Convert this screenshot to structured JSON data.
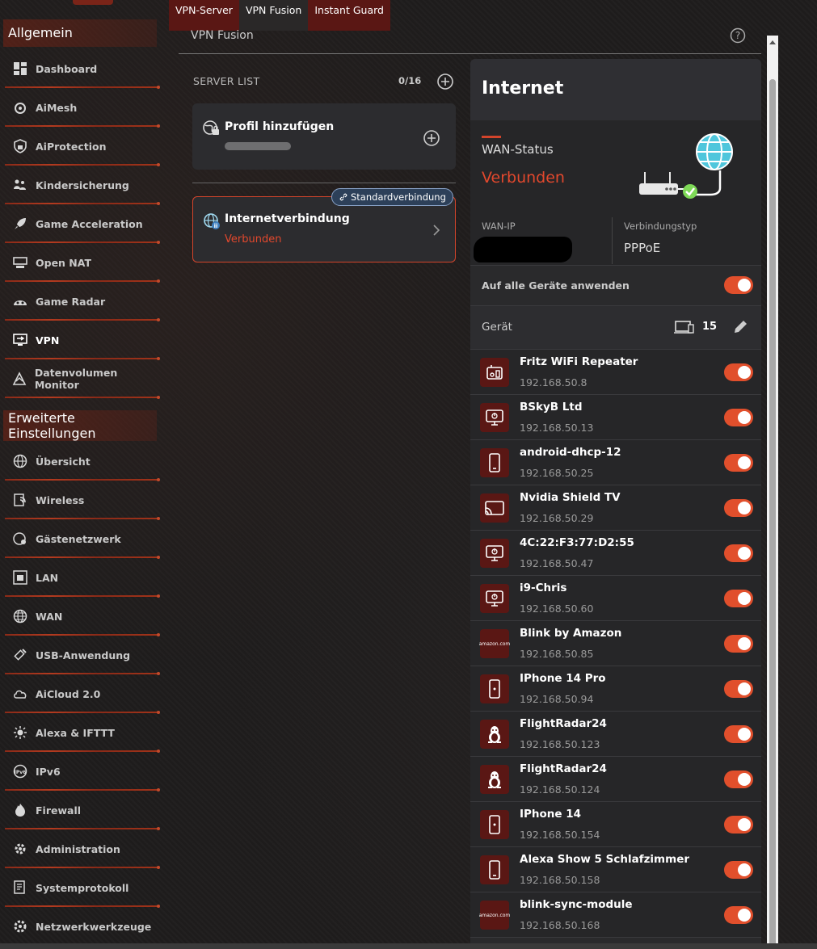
{
  "tabs": [
    {
      "label": "VPN-Server"
    },
    {
      "label": "VPN Fusion"
    },
    {
      "label": "Instant Guard"
    }
  ],
  "sidebar": {
    "section_general": "Allgemein",
    "section_advanced": "Erweiterte Einstellungen",
    "general_items": [
      {
        "label": "Dashboard",
        "icon": "dashboard-icon"
      },
      {
        "label": "AiMesh",
        "icon": "aimesh-icon"
      },
      {
        "label": "AiProtection",
        "icon": "lock-shield-icon"
      },
      {
        "label": "Kindersicherung",
        "icon": "family-icon"
      },
      {
        "label": "Game Acceleration",
        "icon": "rocket-icon"
      },
      {
        "label": "Open NAT",
        "icon": "nat-icon"
      },
      {
        "label": "Game Radar",
        "icon": "radar-icon"
      },
      {
        "label": "VPN",
        "icon": "vpn-icon"
      },
      {
        "label": "Datenvolumen Monitor",
        "icon": "traffic-monitor-icon"
      }
    ],
    "advanced_items": [
      {
        "label": "Übersicht",
        "icon": "overview-globe-icon"
      },
      {
        "label": "Wireless",
        "icon": "wireless-icon"
      },
      {
        "label": "Gästenetzwerk",
        "icon": "guest-network-icon"
      },
      {
        "label": "LAN",
        "icon": "lan-icon"
      },
      {
        "label": "WAN",
        "icon": "wan-globe-icon"
      },
      {
        "label": "USB-Anwendung",
        "icon": "usb-icon"
      },
      {
        "label": "AiCloud 2.0",
        "icon": "cloud-icon"
      },
      {
        "label": "Alexa & IFTTT",
        "icon": "alexa-icon"
      },
      {
        "label": "IPv6",
        "icon": "ipv6-icon"
      },
      {
        "label": "Firewall",
        "icon": "firewall-icon"
      },
      {
        "label": "Administration",
        "icon": "admin-gear-icon"
      },
      {
        "label": "Systemprotokoll",
        "icon": "log-icon"
      },
      {
        "label": "Netzwerkwerkzeuge",
        "icon": "tools-icon"
      }
    ],
    "active_item": "VPN"
  },
  "page": {
    "title": "VPN Fusion"
  },
  "server_list": {
    "label": "SERVER LIST",
    "count": "0/16",
    "add_profile": "Profil hinzufügen",
    "internet_name": "Internetverbindung",
    "internet_status": "Verbunden",
    "default_badge": "Standardverbindung"
  },
  "internet_panel": {
    "title": "Internet",
    "wan_status_label": "WAN-Status",
    "wan_status_value": "Verbunden",
    "wan_ip_label": "WAN-IP",
    "conn_type_label": "Verbindungstyp",
    "conn_type_value": "PPPoE",
    "apply_all_label": "Auf alle Geräte anwenden",
    "apply_all_on": true,
    "devices_label": "Gerät",
    "devices_count": "15"
  },
  "devices": [
    {
      "name": "Fritz WiFi Repeater",
      "ip": "192.168.50.8",
      "icon": "repeater-icon",
      "on": true
    },
    {
      "name": "BSkyB Ltd",
      "ip": "192.168.50.13",
      "icon": "monitor-icon",
      "on": true
    },
    {
      "name": "android-dhcp-12",
      "ip": "192.168.50.25",
      "icon": "phone-icon",
      "on": true
    },
    {
      "name": "Nvidia Shield TV",
      "ip": "192.168.50.29",
      "icon": "cast-icon",
      "on": true
    },
    {
      "name": "4C:22:F3:77:D2:55",
      "ip": "192.168.50.47",
      "icon": "monitor-icon",
      "on": true
    },
    {
      "name": "i9-Chris",
      "ip": "192.168.50.60",
      "icon": "monitor-icon",
      "on": true
    },
    {
      "name": "Blink by Amazon",
      "ip": "192.168.50.85",
      "icon": "amazon-icon",
      "brand": "amazon.com",
      "on": true
    },
    {
      "name": "IPhone 14 Pro",
      "ip": "192.168.50.94",
      "icon": "iphone-icon",
      "on": true
    },
    {
      "name": "FlightRadar24",
      "ip": "192.168.50.123",
      "icon": "linux-icon",
      "on": true
    },
    {
      "name": "FlightRadar24",
      "ip": "192.168.50.124",
      "icon": "linux-icon",
      "on": true
    },
    {
      "name": "IPhone 14",
      "ip": "192.168.50.154",
      "icon": "iphone-icon",
      "on": true
    },
    {
      "name": "Alexa Show 5 Schlafzimmer",
      "ip": "192.168.50.158",
      "icon": "phone-icon",
      "on": true
    },
    {
      "name": "blink-sync-module",
      "ip": "192.168.50.168",
      "icon": "amazon-icon",
      "brand": "amazon.com",
      "on": true
    }
  ],
  "colors": {
    "accent": "#e14f2c",
    "status_red": "#e2482d",
    "tab_red": "#5a1714"
  }
}
